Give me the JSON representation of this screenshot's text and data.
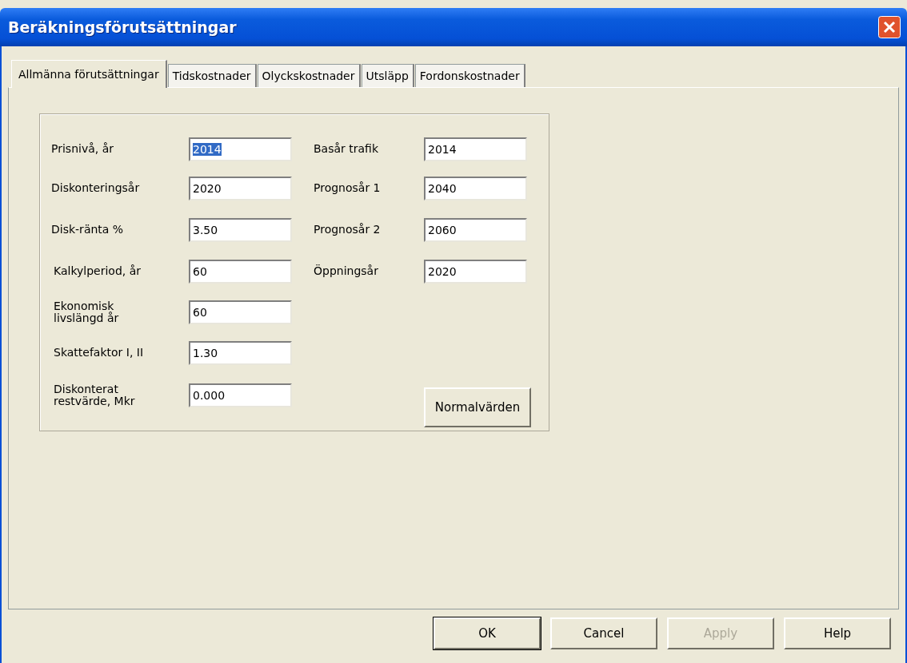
{
  "window": {
    "title": "Beräkningsförutsättningar"
  },
  "tabs": [
    {
      "label": "Allmänna förutsättningar",
      "selected": true
    },
    {
      "label": "Tidskostnader",
      "selected": false
    },
    {
      "label": "Olyckskostnader",
      "selected": false
    },
    {
      "label": "Utsläpp",
      "selected": false
    },
    {
      "label": "Fordonskostnader",
      "selected": false
    }
  ],
  "left_fields": [
    {
      "label": "Prisnivå, år",
      "value": "2014",
      "highlighted": true
    },
    {
      "label": "Diskonteringsår",
      "value": "2020",
      "highlighted": false
    },
    {
      "label": "Disk-ränta %",
      "value": "3.50",
      "highlighted": false
    },
    {
      "label": "Kalkylperiod, år",
      "value": "60",
      "highlighted": false
    },
    {
      "label": "Ekonomisk livslängd år",
      "value": "60",
      "highlighted": false
    },
    {
      "label": "Skattefaktor I, II",
      "value": "1.30",
      "highlighted": false
    },
    {
      "label": "Diskonterat restvärde, Mkr",
      "value": "0.000",
      "highlighted": false
    }
  ],
  "right_fields": [
    {
      "label": "Basår trafik",
      "value": "2014",
      "highlighted": false
    },
    {
      "label": "Prognosår 1",
      "value": "2040",
      "highlighted": false
    },
    {
      "label": "Prognosår 2",
      "value": "2060",
      "highlighted": false
    },
    {
      "label": "Öppningsår",
      "value": "2020",
      "highlighted": false
    }
  ],
  "defaults_button": "Normalvärden",
  "buttons": [
    {
      "label": "OK",
      "disabled": false,
      "default": true
    },
    {
      "label": "Cancel",
      "disabled": false,
      "default": false
    },
    {
      "label": "Apply",
      "disabled": true,
      "default": false
    },
    {
      "label": "Help",
      "disabled": false,
      "default": false
    }
  ]
}
